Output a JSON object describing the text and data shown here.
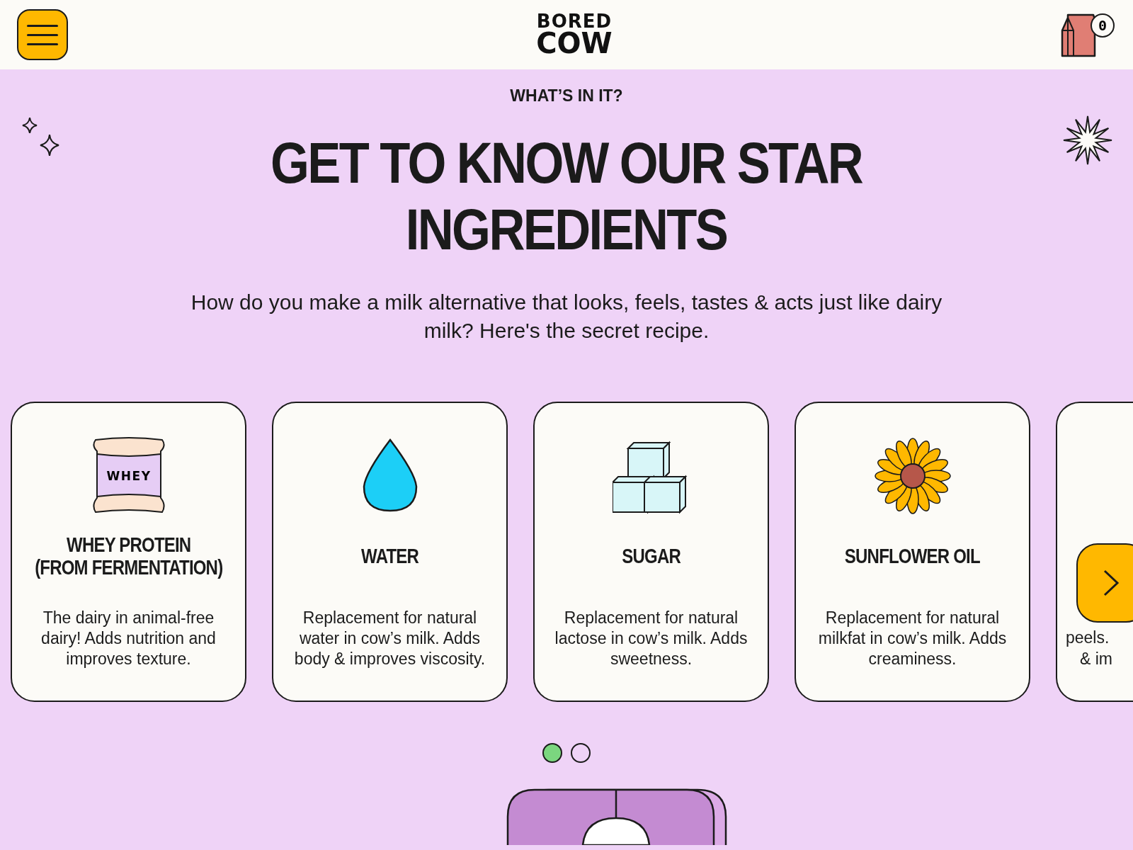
{
  "header": {
    "logo": [
      "BORED",
      "COW"
    ],
    "cart_count": "0"
  },
  "eyebrow": "WHAT’S IN IT?",
  "title": [
    "GET TO KNOW OUR STAR",
    "INGREDIENTS"
  ],
  "intro": "How do you make a milk alternative that looks, feels, tastes & acts just like dairy milk? Here's the secret recipe.",
  "cards": [
    {
      "kind": "bag",
      "icon_label": "WHEY",
      "name": [
        "WHEY PROTEIN",
        "(FROM FERMENTATION)"
      ],
      "description": "The dairy in animal-free dairy! Adds nutrition and improves texture."
    },
    {
      "kind": "drop",
      "name": [
        "WATER"
      ],
      "description": "Replacement for natural water in cow’s milk. Adds body & improves viscosity."
    },
    {
      "kind": "cubes",
      "name": [
        "SUGAR"
      ],
      "description": "Replacement for natural lactose in cow’s milk. Adds sweetness."
    },
    {
      "kind": "flower",
      "name": [
        "SUNFLOWER OIL"
      ],
      "description": "Replacement for natural milkfat in cow’s milk. Adds creaminess."
    }
  ],
  "partial_card": {
    "lines": [
      "peels.",
      "& im"
    ]
  },
  "dots": [
    {
      "selected": true
    },
    {
      "selected": false
    }
  ]
}
